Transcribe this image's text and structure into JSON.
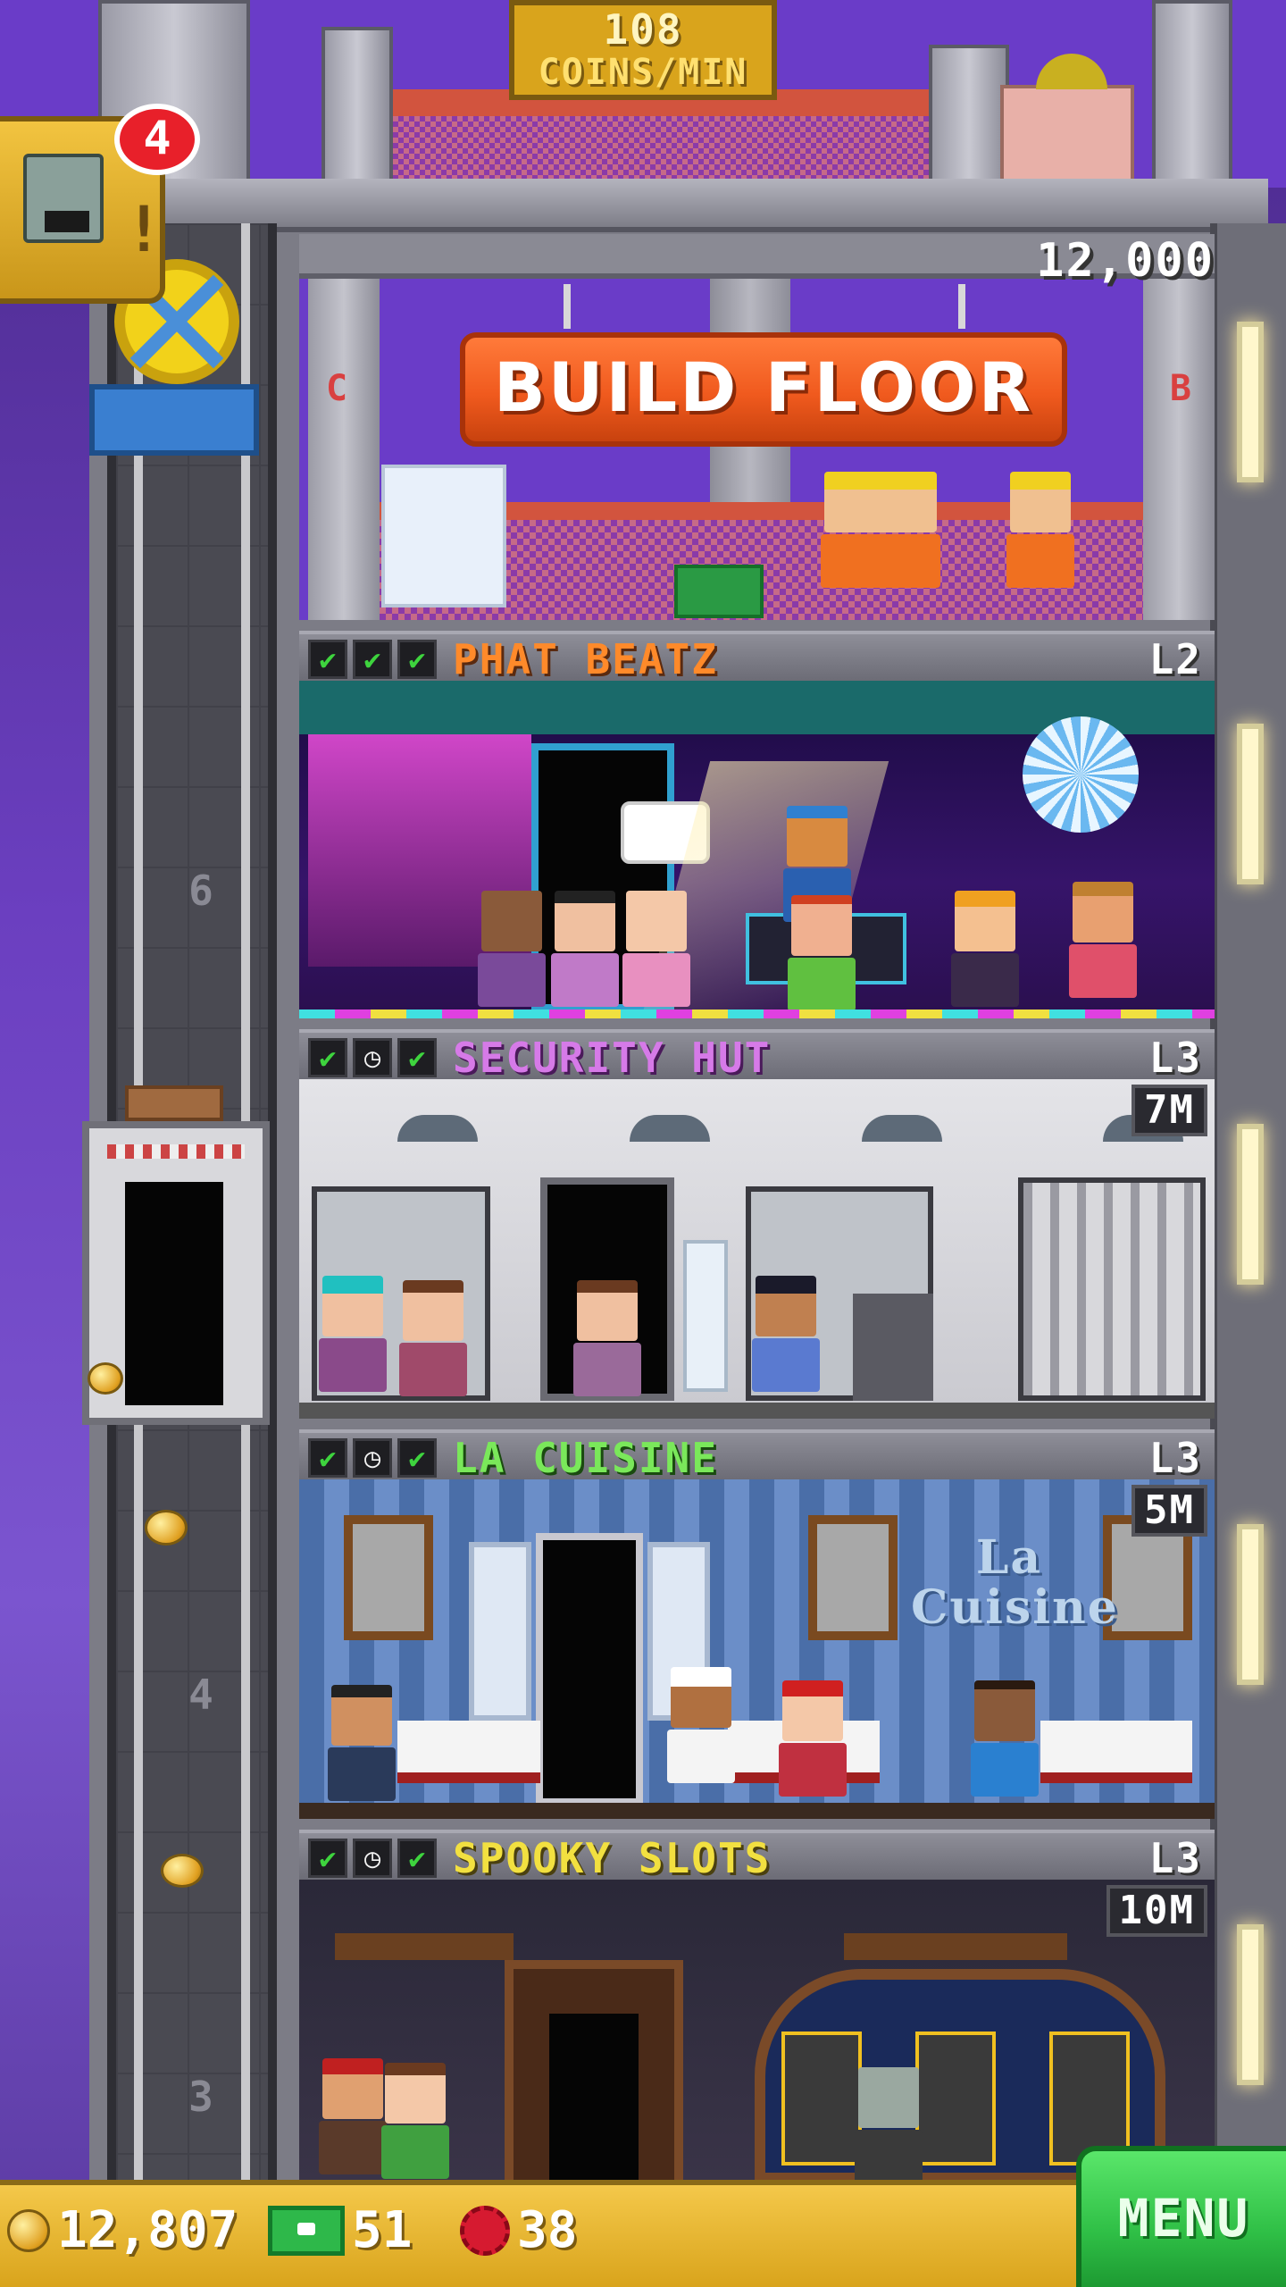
{
  "header": {
    "coins_per_min_value": "108",
    "coins_per_min_label": "COINS/MIN"
  },
  "notification": {
    "count": "4",
    "icon": "zombie-visitor-icon"
  },
  "build_floor": {
    "price": "12,000",
    "button_label": "BUILD FLOOR",
    "side_left": "C",
    "side_right": "B"
  },
  "elevator": {
    "floor_numbers": [
      "6",
      "4",
      "3"
    ]
  },
  "floors": [
    {
      "name": "PHAT BEATZ",
      "level": "L2",
      "income": "",
      "name_color": "#ff8a2a",
      "status": [
        "check",
        "check",
        "check"
      ]
    },
    {
      "name": "SECURITY HUT",
      "level": "L3",
      "income": "7M",
      "name_color": "#d67ae8",
      "status": [
        "check",
        "clock",
        "check"
      ]
    },
    {
      "name": "LA CUISINE",
      "level": "L3",
      "income": "5M",
      "name_color": "#7ae85a",
      "status": [
        "check",
        "clock",
        "check"
      ],
      "sign": "La Cuisine"
    },
    {
      "name": "SPOOKY SLOTS",
      "level": "L3",
      "income": "10M",
      "name_color": "#f2e040",
      "status": [
        "check",
        "clock",
        "check"
      ]
    }
  ],
  "bottom_bar": {
    "coins": "12,807",
    "bux": "51",
    "gems": "38",
    "menu_label": "MENU"
  },
  "colors": {
    "sky": "#6a3cc8",
    "coin_gold": "#d9a41c",
    "menu_green": "#2fbf46",
    "build_orange": "#f05a1e"
  }
}
